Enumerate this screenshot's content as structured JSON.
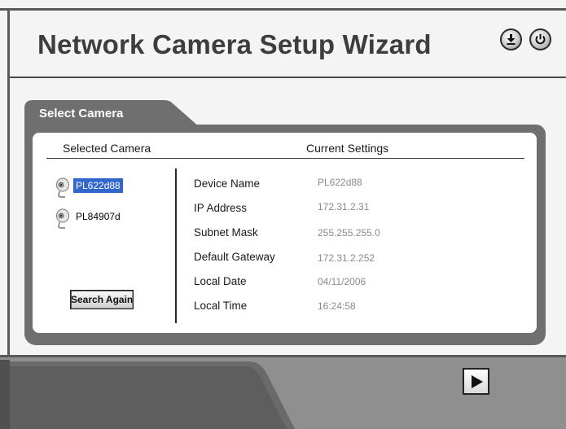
{
  "header": {
    "title": "Network Camera Setup Wizard",
    "icons": [
      "download-icon",
      "power-icon"
    ]
  },
  "tab": {
    "label": "Select Camera"
  },
  "columns": {
    "selected_camera": "Selected Camera",
    "current_settings": "Current Settings"
  },
  "cameras": [
    {
      "name": "PL622d88",
      "selected": true,
      "icon": "camera-icon"
    },
    {
      "name": "PL84907d",
      "selected": false,
      "icon": "camera-icon"
    }
  ],
  "search_button": {
    "label": "Search Again"
  },
  "settings": [
    {
      "label": "Device Name",
      "value": "PL622d88"
    },
    {
      "label": "IP Address",
      "value": "172.31.2.31"
    },
    {
      "label": "Subnet Mask",
      "value": "255.255.255.0"
    },
    {
      "label": "Default Gateway",
      "value": "172.31.2.252"
    },
    {
      "label": "Local Date",
      "value": "04/11/2006"
    },
    {
      "label": "Local Time",
      "value": "16:24:58"
    }
  ],
  "footer": {
    "next_icon": "play-next-icon"
  },
  "colors": {
    "selection": "#3266cc",
    "panel_frame": "#6f6f6f",
    "footer": "#8f8f8f"
  }
}
